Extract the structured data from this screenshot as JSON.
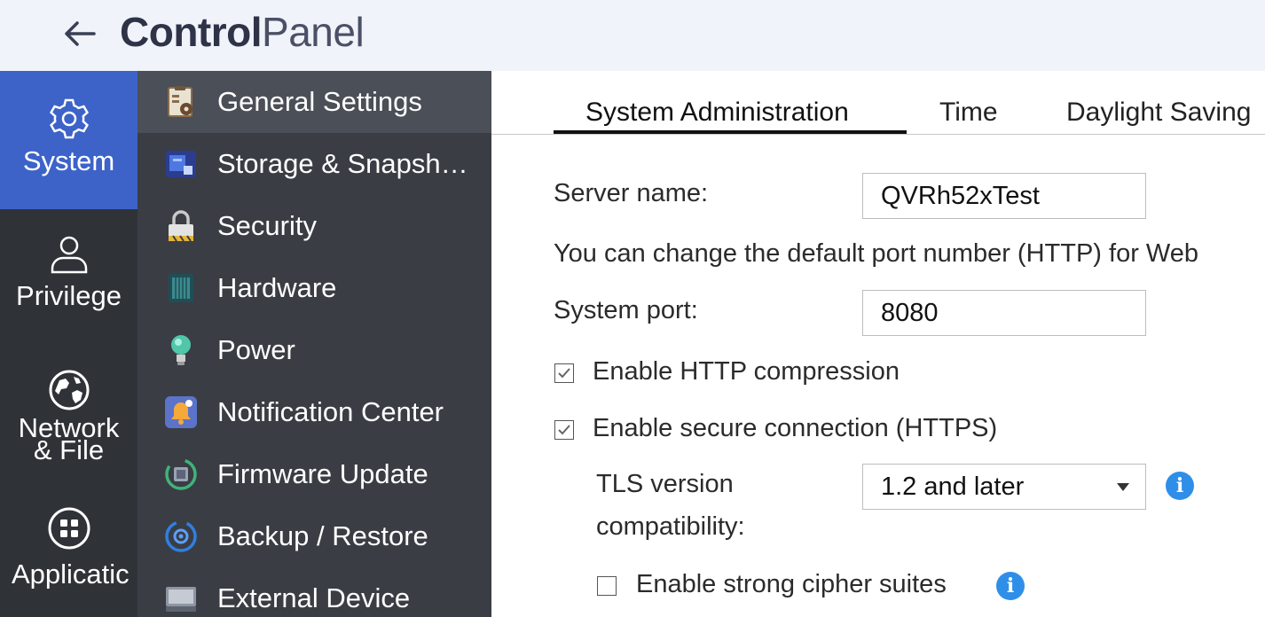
{
  "header": {
    "title_bold": "Control",
    "title_light": "Panel"
  },
  "rail": {
    "items": [
      {
        "label": "System",
        "icon": "gear-icon",
        "active": true
      },
      {
        "label": "Privilege",
        "icon": "user-icon"
      },
      {
        "label": "Network\n& File",
        "label_line1": "Network",
        "label_line2": "& File",
        "icon": "globe-icon"
      },
      {
        "label": "Applicatic",
        "icon": "apps-grid-icon"
      }
    ]
  },
  "menu": {
    "items": [
      {
        "label": "General Settings",
        "icon": "general-settings-icon",
        "active": true
      },
      {
        "label": "Storage & Snapsh…",
        "icon": "storage-icon"
      },
      {
        "label": "Security",
        "icon": "lock-icon"
      },
      {
        "label": "Hardware",
        "icon": "hardware-icon"
      },
      {
        "label": "Power",
        "icon": "bulb-icon"
      },
      {
        "label": "Notification Center",
        "icon": "bell-icon"
      },
      {
        "label": "Firmware Update",
        "icon": "firmware-icon"
      },
      {
        "label": "Backup / Restore",
        "icon": "backup-icon"
      },
      {
        "label": "External Device",
        "icon": "external-device-icon"
      }
    ]
  },
  "tabs": [
    {
      "label": "System Administration",
      "active": true
    },
    {
      "label": "Time"
    },
    {
      "label": "Daylight Saving"
    }
  ],
  "form": {
    "server_name_label": "Server name:",
    "server_name_value": "QVRh52xTest",
    "port_hint": "You can change the default port number (HTTP) for Web",
    "system_port_label": "System port:",
    "system_port_value": "8080",
    "http_compression_label": "Enable HTTP compression",
    "http_compression_checked": true,
    "https_label": "Enable secure connection (HTTPS)",
    "https_checked": true,
    "tls_label_line1": "TLS version",
    "tls_label_line2": "compatibility:",
    "tls_value": "1.2 and later",
    "cipher_label": "Enable strong cipher suites",
    "cipher_checked": false,
    "info_glyph": "i"
  },
  "colors": {
    "rail_bg": "#2f3237",
    "rail_active": "#3d63c9",
    "menu_bg": "#3a3d44",
    "menu_active": "#4b4f57",
    "header_bg": "#f1f3fb",
    "info_blue": "#2f8fe8"
  }
}
